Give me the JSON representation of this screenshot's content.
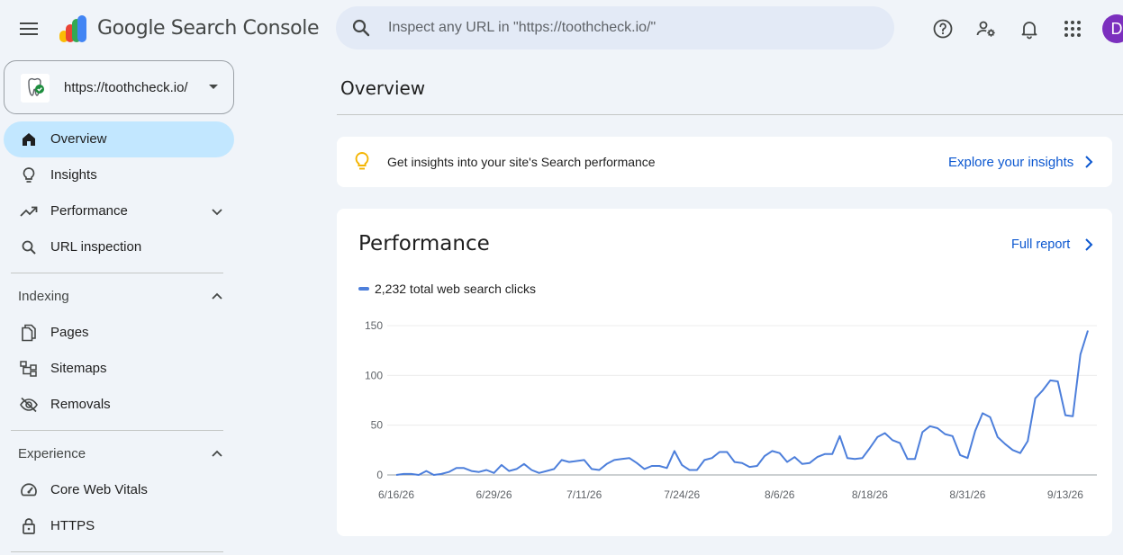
{
  "header": {
    "product_name": "Google Search Console",
    "search_placeholder": "Inspect any URL in \"https://toothcheck.io/\"",
    "avatar_initial": "D",
    "icons": [
      "menu-icon",
      "search-icon",
      "help-icon",
      "manage-users-icon",
      "notifications-icon",
      "apps-icon"
    ]
  },
  "property": {
    "url": "https://toothcheck.io/"
  },
  "sidebar": {
    "items": [
      {
        "label": "Overview",
        "icon": "home-icon",
        "active": true
      },
      {
        "label": "Insights",
        "icon": "lightbulb-icon"
      },
      {
        "label": "Performance",
        "icon": "trending-up-icon",
        "expandable": true
      },
      {
        "label": "URL inspection",
        "icon": "search-icon"
      }
    ],
    "sections": [
      {
        "title": "Indexing",
        "expanded": true,
        "items": [
          {
            "label": "Pages",
            "icon": "pages-icon"
          },
          {
            "label": "Sitemaps",
            "icon": "sitemap-icon"
          },
          {
            "label": "Removals",
            "icon": "visibility-off-icon"
          }
        ]
      },
      {
        "title": "Experience",
        "expanded": true,
        "items": [
          {
            "label": "Core Web Vitals",
            "icon": "speed-icon"
          },
          {
            "label": "HTTPS",
            "icon": "lock-icon"
          }
        ]
      }
    ]
  },
  "main": {
    "title": "Overview",
    "insights_card": {
      "text": "Get insights into your site's Search performance",
      "link": "Explore your insights"
    },
    "performance": {
      "title": "Performance",
      "full_report": "Full report",
      "legend": "2,232 total web search clicks"
    }
  },
  "colors": {
    "accent": "#0b57d0",
    "line": "#4d7fdb",
    "active_nav": "#c2e7ff",
    "avatar": "#7b2fbe",
    "bulb": "#f4b400"
  },
  "chart_data": {
    "type": "line",
    "title": "",
    "xlabel": "",
    "ylabel": "",
    "ylim": [
      0,
      150
    ],
    "yticks": [
      0,
      50,
      100,
      150
    ],
    "xticks": [
      "6/16/26",
      "6/29/26",
      "7/11/26",
      "7/24/26",
      "8/6/26",
      "8/18/26",
      "8/31/26",
      "9/13/26"
    ],
    "grid": true,
    "legend": "top-left",
    "series": [
      {
        "name": "2,232 total web search clicks",
        "start": "2026-06-16",
        "values": [
          0,
          1,
          1,
          0,
          4,
          0,
          1,
          3,
          7,
          7,
          4,
          3,
          5,
          2,
          10,
          4,
          6,
          11,
          5,
          2,
          4,
          6,
          15,
          13,
          14,
          15,
          6,
          5,
          11,
          15,
          16,
          17,
          12,
          6,
          9,
          9,
          7,
          24,
          10,
          5,
          5,
          15,
          17,
          23,
          23,
          13,
          12,
          8,
          9,
          19,
          24,
          22,
          13,
          18,
          11,
          12,
          18,
          21,
          21,
          39,
          17,
          16,
          17,
          27,
          38,
          42,
          35,
          32,
          16,
          16,
          43,
          49,
          47,
          41,
          39,
          20,
          17,
          44,
          62,
          58,
          38,
          31,
          25,
          22,
          34,
          77,
          85,
          95,
          94,
          60,
          59,
          121,
          145
        ]
      }
    ]
  }
}
